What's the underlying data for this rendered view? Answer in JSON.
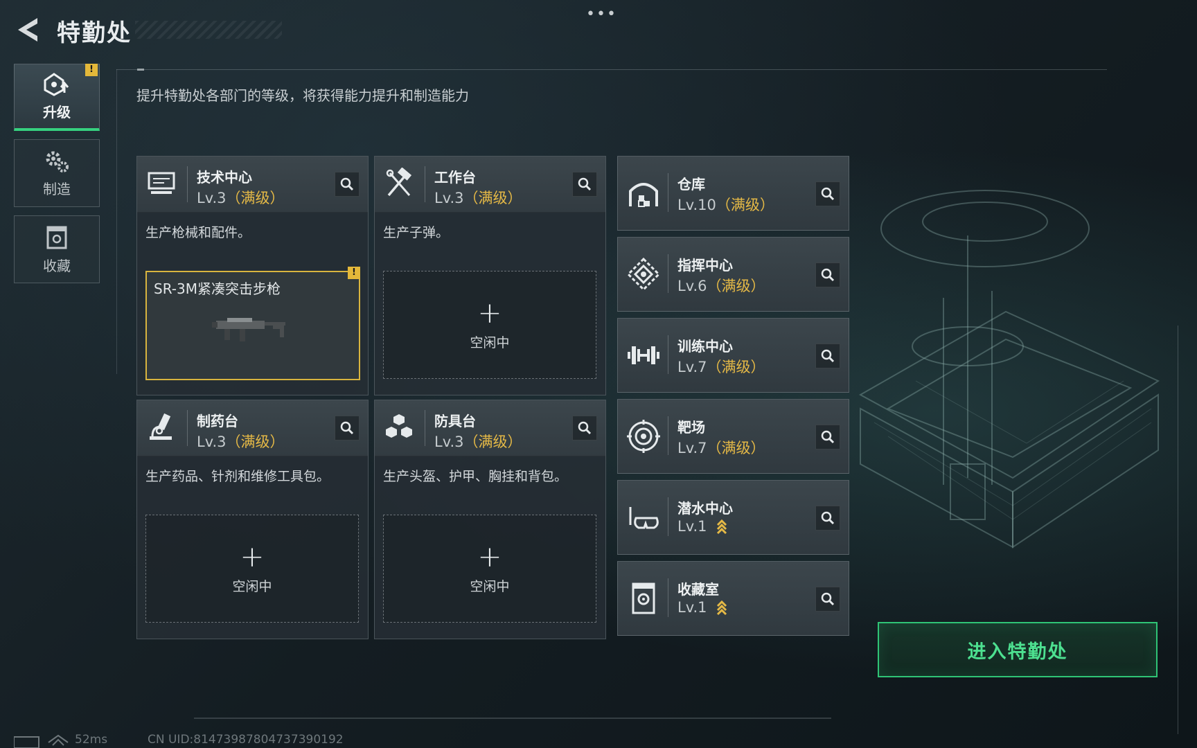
{
  "header": {
    "title": "特勤处",
    "menu_dots": "•••"
  },
  "hint": "提升特勤处各部门的等级，将获得能力提升和制造能力",
  "sidebar": {
    "items": [
      {
        "label": "升级",
        "badge": "!",
        "active": true,
        "icon": "upgrade-icon"
      },
      {
        "label": "制造",
        "icon": "gears-icon"
      },
      {
        "label": "收藏",
        "icon": "collection-icon"
      }
    ]
  },
  "cards": [
    {
      "name": "技术中心",
      "level": "Lv.3",
      "max": "（满级）",
      "desc": "生产枪械和配件。",
      "icon": "computer-icon",
      "slot": {
        "item": "SR-3M紧凑突击步枪",
        "badge": "!"
      }
    },
    {
      "name": "工作台",
      "level": "Lv.3",
      "max": "（满级）",
      "desc": "生产子弹。",
      "icon": "tools-icon",
      "slot": {
        "plus": "+",
        "idle": "空闲中"
      }
    },
    {
      "name": "制药台",
      "level": "Lv.3",
      "max": "（满级）",
      "desc": "生产药品、针剂和维修工具包。",
      "icon": "microscope-icon",
      "slot": {
        "plus": "+",
        "idle": "空闲中"
      }
    },
    {
      "name": "防具台",
      "level": "Lv.3",
      "max": "（满级）",
      "desc": "生产头盔、护甲、胸挂和背包。",
      "icon": "cubes-icon",
      "slot": {
        "plus": "+",
        "idle": "空闲中"
      }
    }
  ],
  "facilities": [
    {
      "name": "仓库",
      "level": "Lv.10",
      "max": "（满级）",
      "icon": "warehouse-icon"
    },
    {
      "name": "指挥中心",
      "level": "Lv.6",
      "max": "（满级）",
      "icon": "command-icon"
    },
    {
      "name": "训练中心",
      "level": "Lv.7",
      "max": "（满级）",
      "icon": "dumbbell-icon"
    },
    {
      "name": "靶场",
      "level": "Lv.7",
      "max": "（满级）",
      "icon": "target-icon"
    },
    {
      "name": "潜水中心",
      "level": "Lv.1",
      "max": "",
      "upgradable": true,
      "icon": "diving-mask-icon"
    },
    {
      "name": "收藏室",
      "level": "Lv.1",
      "max": "",
      "upgradable": true,
      "icon": "vault-icon"
    }
  ],
  "enter_button": "进入特勤处",
  "footer": {
    "ping": "52ms",
    "uid": "CN UID:8147398780473739019​2"
  },
  "colors": {
    "accent_green": "#36d17f",
    "max_gold": "#e5b946",
    "badge_yellow": "#e4b83a"
  }
}
